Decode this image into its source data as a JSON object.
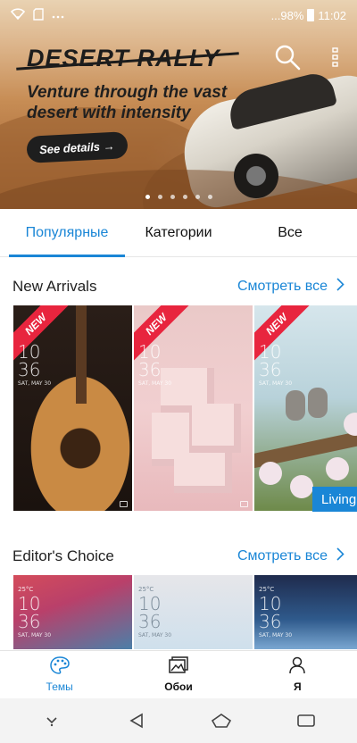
{
  "status_bar": {
    "battery_percent": "...98%",
    "time": "11:02"
  },
  "banner": {
    "title": "DESERT RALLY",
    "subtitle": "Venture through the vast desert with intensity",
    "cta_label": "See details →",
    "pager_count": 6,
    "active_page": 0
  },
  "tabs": [
    {
      "label": "Популярные",
      "active": true
    },
    {
      "label": "Категории",
      "active": false
    },
    {
      "label": "Все",
      "active": false
    }
  ],
  "new_arrivals": {
    "title": "New Arrivals",
    "link_label": "Смотреть все",
    "cards": [
      {
        "badge": "NEW",
        "time_hour": "10",
        "time_min": "36",
        "date": "SAT, MAY 30"
      },
      {
        "badge": "NEW",
        "time_hour": "10",
        "time_min": "36",
        "date": "SAT, MAY 30"
      },
      {
        "badge": "NEW",
        "time_hour": "10",
        "time_min": "36",
        "date": "SAT, MAY 30"
      }
    ],
    "overflow_label": "Living"
  },
  "editors_choice": {
    "title": "Editor's Choice",
    "link_label": "Смотреть все",
    "cards": [
      {
        "weather": "25°C",
        "time_hour": "10",
        "time_min": "36",
        "date": "SAT, MAY 30"
      },
      {
        "weather": "25°C",
        "time_hour": "10",
        "time_min": "36",
        "date": "SAT, MAY 30"
      },
      {
        "weather": "25°C",
        "time_hour": "10",
        "time_min": "36",
        "date": "SAT, MAY 30"
      }
    ]
  },
  "bottom_nav": [
    {
      "label": "Темы",
      "icon": "palette-icon",
      "active": true
    },
    {
      "label": "Обои",
      "icon": "wallpaper-icon",
      "active": false
    },
    {
      "label": "Я",
      "icon": "person-icon",
      "active": false
    }
  ],
  "colors": {
    "accent": "#1a86d6",
    "new_badge": "#e8253e"
  }
}
